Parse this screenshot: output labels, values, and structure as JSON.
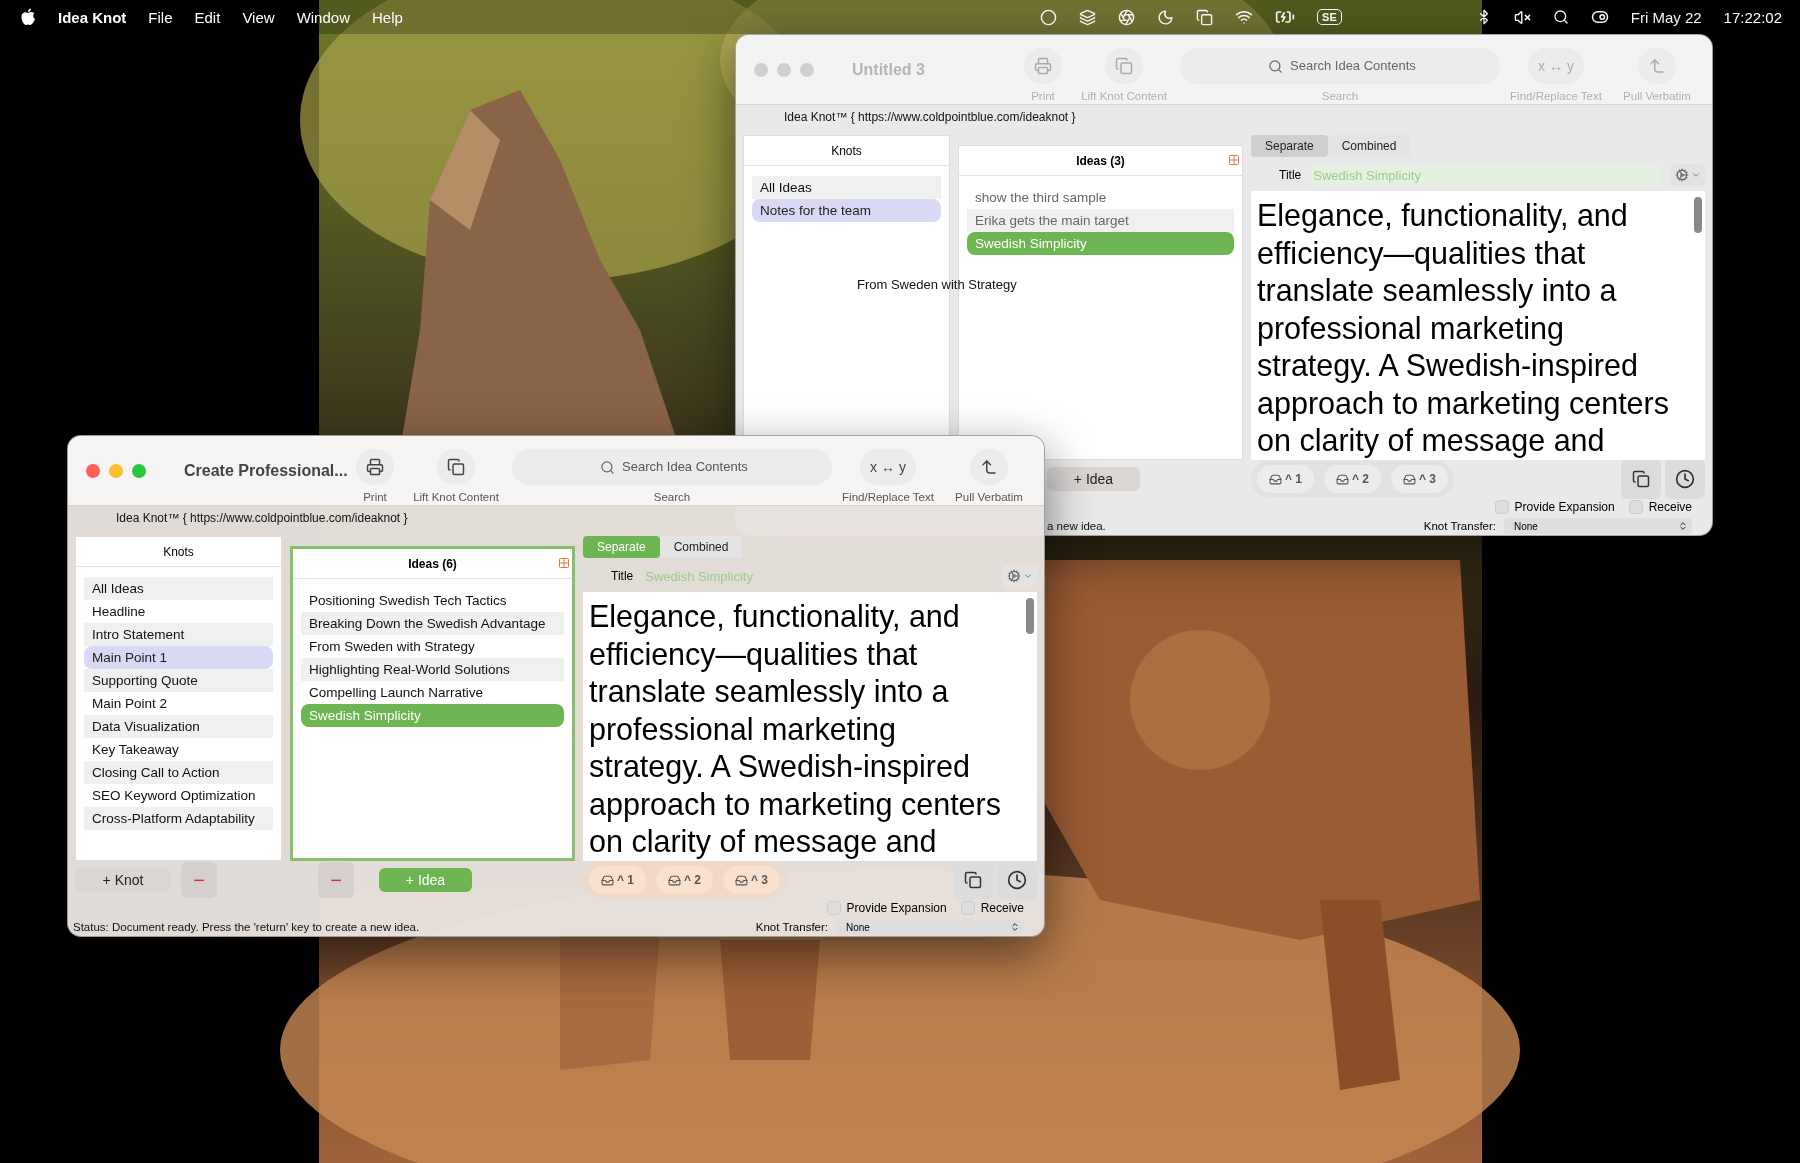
{
  "menu_bar": {
    "app_name": "Idea Knot",
    "menus": [
      "File",
      "Edit",
      "View",
      "Window",
      "Help"
    ],
    "input_badge": "SE",
    "date": "Fri May 22",
    "time": "17:22:02"
  },
  "windows": [
    {
      "title": "Untitled 3",
      "active": false,
      "toolbar": [
        {
          "kind": "print",
          "label": "Print"
        },
        {
          "kind": "lift",
          "label": "Lift Knot Content"
        },
        {
          "kind": "search",
          "label": "Search",
          "placeholder": "Search Idea Contents"
        },
        {
          "kind": "swap",
          "label": "Find/Replace Text",
          "glyph": "x ↔ y"
        },
        {
          "kind": "pull",
          "label": "Pull Verbatim"
        }
      ],
      "url_line": "Idea Knot™ { https://www.coldpointblue.com/ideaknot }",
      "knots": {
        "header": "Knots",
        "items": [
          {
            "label": "All Ideas",
            "selected": false
          },
          {
            "label": "Notes for the team",
            "selected": true
          }
        ]
      },
      "ideas": {
        "header": "Ideas (3)",
        "items": [
          {
            "label": "show the third sample",
            "selected": false
          },
          {
            "label": "Erika gets the main target",
            "selected": false
          },
          {
            "label": "Swedish Simplicity",
            "selected": true
          }
        ]
      },
      "drag_label": "From Sweden with Strategy",
      "editor": {
        "tabs": [
          {
            "label": "Separate",
            "selected": true
          },
          {
            "label": "Combined",
            "selected": false
          }
        ],
        "title_label": "Title",
        "title_value": "Swedish Simplicity",
        "body": "Elegance, functionality, and efficiency—qualities that translate seamlessly into a professional marketing strategy. A Swedish-inspired approach to marketing centers on clarity of message and"
      },
      "idea_buttons": [
        {
          "kind": "add",
          "label": "+ Idea"
        }
      ],
      "key_buttons": [
        "^ 1",
        "^ 2",
        "^ 3"
      ],
      "options": [
        {
          "label": "Provide Expansion",
          "checked": false
        },
        {
          "label": "Receive",
          "checked": false
        }
      ],
      "transfer": {
        "label": "Knot Transfer:",
        "value": "None"
      },
      "status": "a new idea."
    },
    {
      "title": "Create Professional...",
      "active": true,
      "toolbar": [
        {
          "kind": "print",
          "label": "Print"
        },
        {
          "kind": "lift",
          "label": "Lift Knot Content"
        },
        {
          "kind": "search",
          "label": "Search",
          "placeholder": "Search Idea Contents"
        },
        {
          "kind": "swap",
          "label": "Find/Replace Text",
          "glyph": "x ↔ y"
        },
        {
          "kind": "pull",
          "label": "Pull Verbatim"
        }
      ],
      "url_line": "Idea Knot™ { https://www.coldpointblue.com/ideaknot }",
      "knots": {
        "header": "Knots",
        "items": [
          {
            "label": "All Ideas",
            "selected": false
          },
          {
            "label": "Headline",
            "selected": false
          },
          {
            "label": "Intro Statement",
            "selected": false
          },
          {
            "label": "Main Point 1",
            "selected": true
          },
          {
            "label": "Supporting Quote",
            "selected": false
          },
          {
            "label": "Main Point 2",
            "selected": false
          },
          {
            "label": "Data Visualization",
            "selected": false
          },
          {
            "label": "Key Takeaway",
            "selected": false
          },
          {
            "label": "Closing Call to Action",
            "selected": false
          },
          {
            "label": "SEO Keyword Optimization",
            "selected": false
          },
          {
            "label": "Cross-Platform Adaptability",
            "selected": false
          }
        ]
      },
      "ideas": {
        "header": "Ideas (6)",
        "items": [
          {
            "label": "Positioning Swedish Tech Tactics",
            "selected": false
          },
          {
            "label": "Breaking Down the Swedish Advantage",
            "selected": false
          },
          {
            "label": "From Sweden with Strategy",
            "selected": false
          },
          {
            "label": "Highlighting Real-World Solutions",
            "selected": false
          },
          {
            "label": "Compelling Launch Narrative",
            "selected": false
          },
          {
            "label": "Swedish Simplicity",
            "selected": true
          }
        ]
      },
      "editor": {
        "tabs": [
          {
            "label": "Separate",
            "selected": true
          },
          {
            "label": "Combined",
            "selected": false
          }
        ],
        "title_label": "Title",
        "title_value": "Swedish Simplicity",
        "body": "Elegance, functionality, and efficiency—qualities that translate seamlessly into a professional marketing strategy. A Swedish-inspired approach to marketing centers on clarity of message and"
      },
      "knot_buttons": [
        {
          "kind": "add",
          "label": "+ Knot"
        },
        {
          "kind": "remove",
          "label": "−"
        }
      ],
      "idea_buttons": [
        {
          "kind": "remove",
          "label": "−"
        },
        {
          "kind": "add",
          "label": "+ Idea"
        }
      ],
      "key_buttons": [
        "^ 1",
        "^ 2",
        "^ 3"
      ],
      "options": [
        {
          "label": "Provide Expansion",
          "checked": false
        },
        {
          "label": "Receive",
          "checked": false
        }
      ],
      "transfer": {
        "label": "Knot Transfer:",
        "value": "None"
      },
      "status": "Status: Document ready. Press the 'return' key to create a new idea."
    }
  ]
}
